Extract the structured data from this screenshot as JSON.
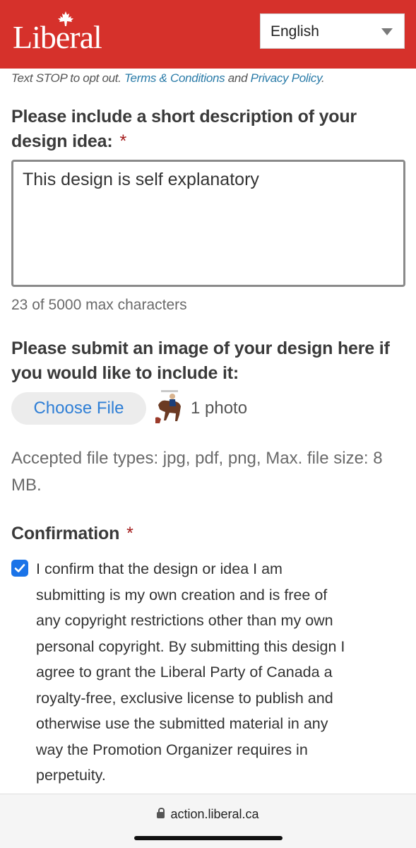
{
  "header": {
    "logo_text": "Liberal",
    "language_selected": "English",
    "brand_color": "#d6312b"
  },
  "optout": {
    "prefix": "Text STOP to opt out. ",
    "terms_link": "Terms & Conditions",
    "middle": " and ",
    "privacy_link": "Privacy Policy",
    "suffix": "."
  },
  "description": {
    "label_line1": "Please include a short description of your",
    "label_line2": "design idea:",
    "required_mark": "*",
    "value": "This design is self explanatory",
    "counter": "23 of 5000 max characters"
  },
  "upload": {
    "label_line1": "Please submit an image of your design here if",
    "label_line2": "you would like to include it:",
    "button_label": "Choose File",
    "file_status": "1 photo",
    "accepted_line1": "Accepted file types: jpg, pdf, png, Max. file size: 8",
    "accepted_line2": "MB."
  },
  "confirmation": {
    "label": "Confirmation",
    "required_mark": "*",
    "checked": true,
    "lines": [
      "I confirm that the design or idea I am",
      "submitting is my own creation and is free of",
      "any copyright restrictions other than my own",
      "personal copyright. By submitting this design I",
      "agree to grant the Liberal Party of Canada a",
      "royalty-free, exclusive license to publish and",
      "otherwise use the submitted material in any",
      "way the Promotion Organizer requires in",
      "perpetuity."
    ]
  },
  "browser": {
    "url": "action.liberal.ca"
  }
}
